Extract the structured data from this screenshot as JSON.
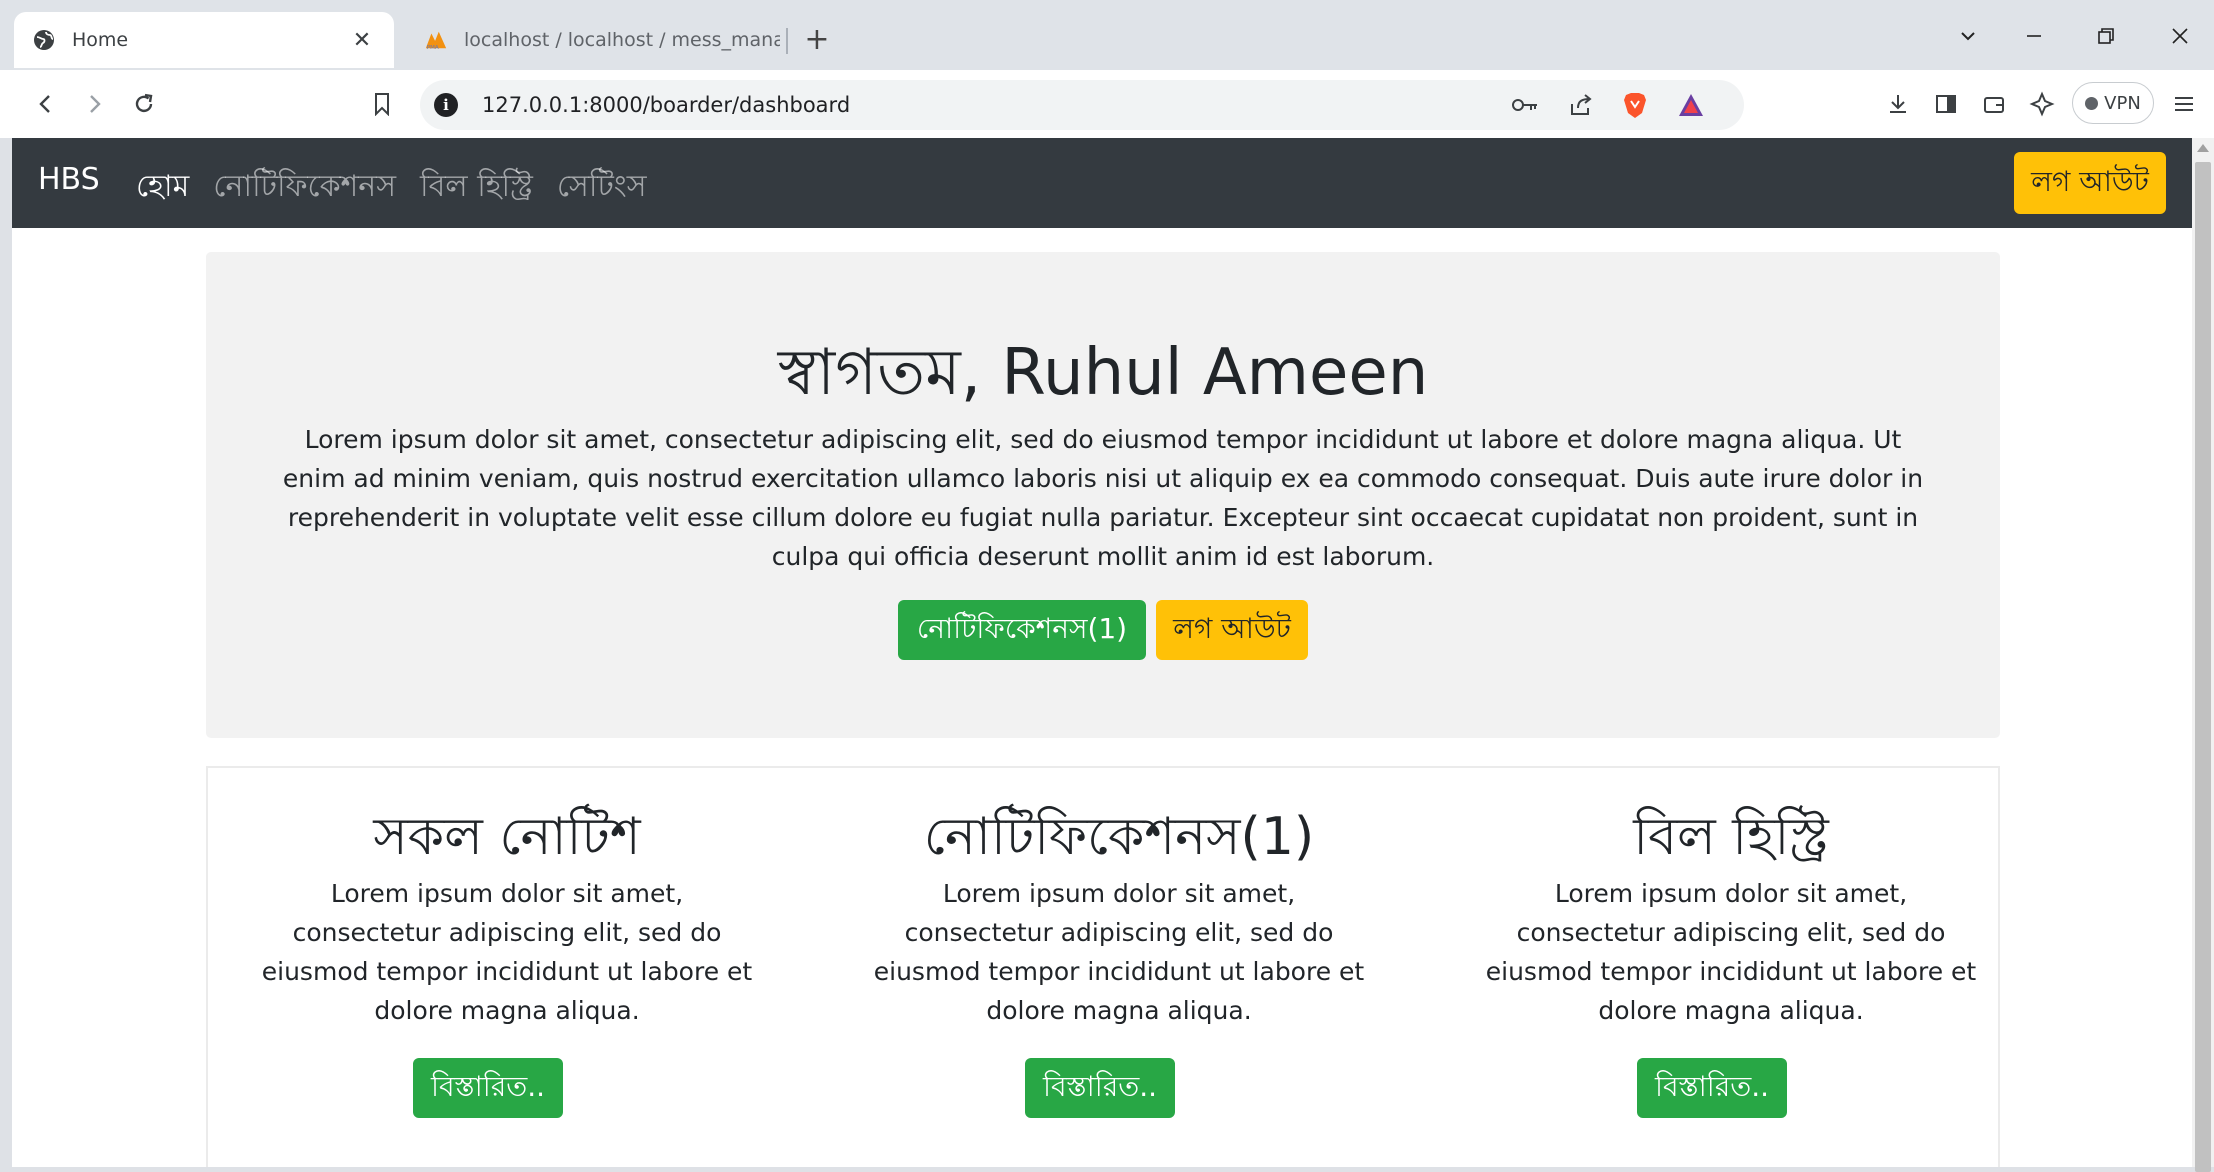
{
  "browser": {
    "tabs": [
      {
        "title": "Home",
        "active": true
      },
      {
        "title": "localhost / localhost / mess_manage",
        "active": false
      }
    ],
    "url": "127.0.0.1:8000/boarder/dashboard",
    "vpn_label": "VPN"
  },
  "navbar": {
    "brand": "HBS",
    "links": [
      "হোম",
      "নোটিফিকেশনস",
      "বিল হিস্ট্রি",
      "সেটিংস"
    ],
    "logout": "লগ আউট"
  },
  "hero": {
    "title": "স্বাগতম, Ruhul Ameen",
    "text": "Lorem ipsum dolor sit amet, consectetur adipiscing elit, sed do eiusmod tempor incididunt ut labore et dolore magna aliqua. Ut enim ad minim veniam, quis nostrud exercitation ullamco laboris nisi ut aliquip ex ea commodo consequat. Duis aute irure dolor in reprehenderit in voluptate velit esse cillum dolore eu fugiat nulla pariatur. Excepteur sint occaecat cupidatat non proident, sunt in culpa qui officia deserunt mollit anim id est laborum.",
    "notifications_button": "নোটিফিকেশনস(1)",
    "logout_button": "লগ আউট"
  },
  "cards": [
    {
      "title": "সকল নোটিশ",
      "text": "Lorem ipsum dolor sit amet, consectetur adipiscing elit, sed do eiusmod tempor incididunt ut labore et dolore magna aliqua.",
      "button": "বিস্তারিত.."
    },
    {
      "title": "নোটিফিকেশনস(1)",
      "text": "Lorem ipsum dolor sit amet, consectetur adipiscing elit, sed do eiusmod tempor incididunt ut labore et dolore magna aliqua.",
      "button": "বিস্তারিত.."
    },
    {
      "title": "বিল হিস্ট্রি",
      "text": "Lorem ipsum dolor sit amet, consectetur adipiscing elit, sed do eiusmod tempor incididunt ut labore et dolore magna aliqua.",
      "button": "বিস্তারিত.."
    }
  ],
  "colors": {
    "navbar": "#343a40",
    "success": "#28a745",
    "warning": "#ffc107",
    "hero_bg": "#f2f2f2"
  },
  "icons": [
    "globe-icon",
    "phpmyadmin-icon",
    "close-icon",
    "new-tab-icon",
    "tab-search-icon",
    "minimize-icon",
    "restore-icon",
    "window-close-icon",
    "back-icon",
    "forward-icon",
    "reload-icon",
    "bookmark-icon",
    "site-info-icon",
    "key-icon",
    "share-icon",
    "brave-shields-icon",
    "brave-rewards-icon",
    "download-icon",
    "sidebar-icon",
    "wallet-icon",
    "leo-ai-icon",
    "menu-icon"
  ]
}
